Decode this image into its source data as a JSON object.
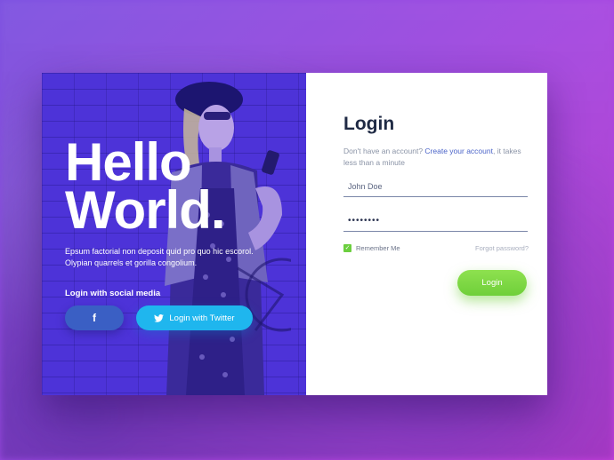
{
  "hero": {
    "headline_line1": "Hello",
    "headline_line2": "World.",
    "tagline": "Epsum factorial non deposit quid pro quo hic escorol. Olypian quarrels et gorilla congolium.",
    "social_label": "Login with social media",
    "facebook_icon": "f",
    "twitter_label": "Login with Twitter"
  },
  "form": {
    "title": "Login",
    "subtitle_prefix": "Don't have an account?",
    "subtitle_link": "Create your account",
    "subtitle_suffix": ", it takes less than a minute",
    "username_value": "John Doe",
    "password_value": "••••••••",
    "remember_label": "Remember Me",
    "remember_checked": true,
    "forgot_label": "Forgot password?",
    "login_button": "Login"
  },
  "colors": {
    "accent_green": "#6fcf3a",
    "twitter_blue": "#1fb6ee",
    "facebook_blue": "#3a5fc4",
    "overlay_purple": "#4a2fd6"
  },
  "icons": {
    "facebook": "facebook-icon",
    "twitter": "twitter-icon",
    "check": "check-icon"
  }
}
